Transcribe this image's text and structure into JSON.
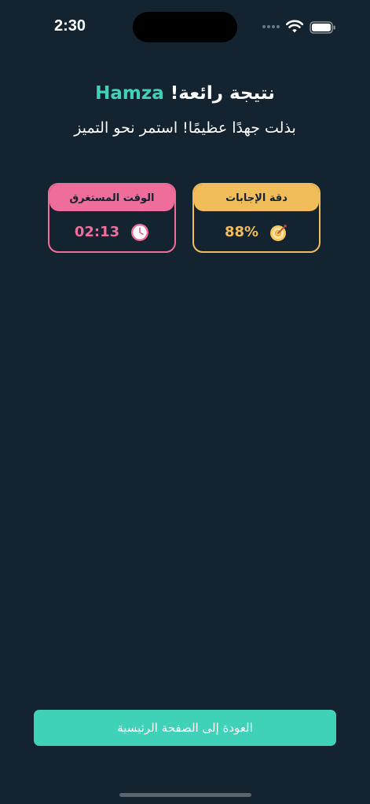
{
  "status_bar": {
    "time": "2:30"
  },
  "header": {
    "title_prefix": "نتيجة رائعة!",
    "name": "Hamza",
    "subtitle": "بذلت جهدًا عظيمًا! استمر نحو التميز"
  },
  "cards": {
    "accuracy": {
      "label": "دقة الإجابات",
      "value": "88%",
      "icon": "target-icon",
      "color": "#f1bd5a"
    },
    "time": {
      "label": "الوقت المستغرق",
      "value": "02:13",
      "icon": "clock-icon",
      "color": "#ee6d9a"
    }
  },
  "actions": {
    "home_label": "العودة إلى الصفحة الرئيسية",
    "accent": "#40d1b9"
  },
  "theme": {
    "background": "#13232f"
  }
}
